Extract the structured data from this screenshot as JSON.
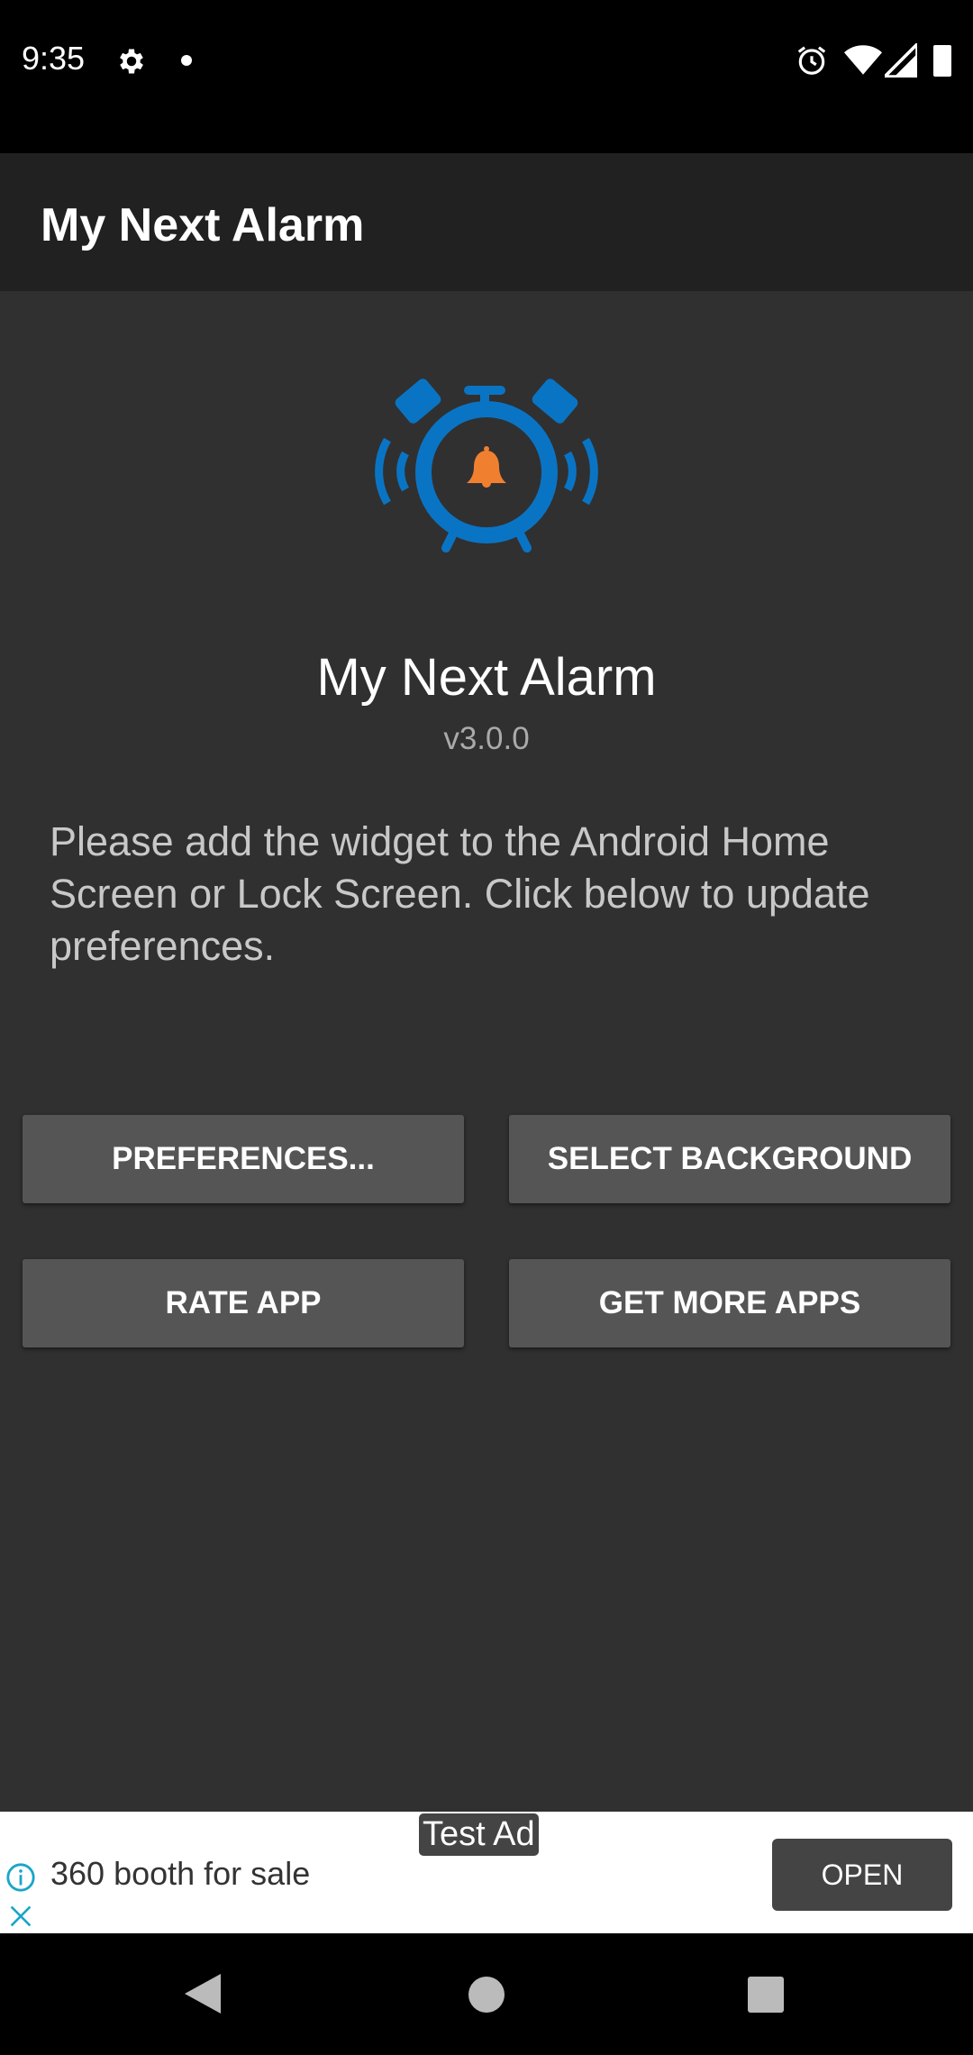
{
  "status_bar": {
    "time": "9:35",
    "icons": [
      "gear-icon",
      "dot-icon",
      "alarm-icon",
      "wifi-icon",
      "signal-icon",
      "battery-icon"
    ]
  },
  "app_bar": {
    "title": "My Next Alarm"
  },
  "main": {
    "app_name": "My Next Alarm",
    "version": "v3.0.0",
    "description": "Please add the widget to the Android Home Screen or Lock Screen. Click below to update preferences.",
    "buttons": [
      "PREFERENCES...",
      "SELECT BACKGROUND",
      "RATE APP",
      "GET MORE APPS"
    ]
  },
  "ad": {
    "tag": "Test Ad",
    "text": "360 booth for sale",
    "cta": "OPEN"
  },
  "colors": {
    "logo_blue": "#0a74c4",
    "bell_orange": "#f08030",
    "ad_icon": "#1aa5c8"
  }
}
